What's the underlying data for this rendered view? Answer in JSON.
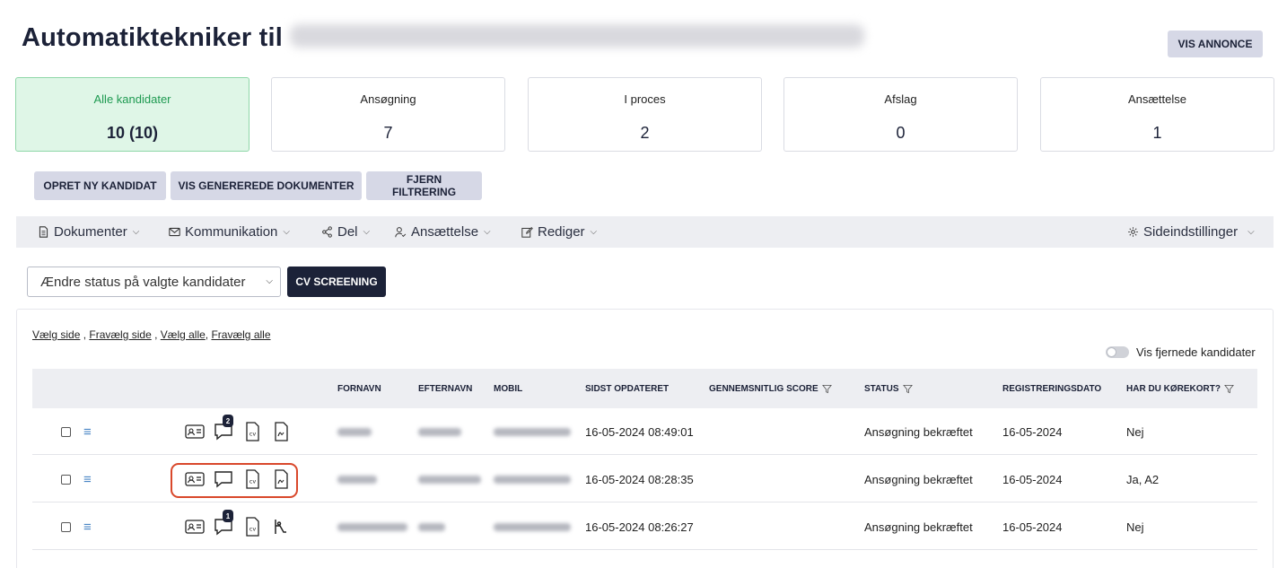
{
  "header": {
    "title": "Automatiktekniker til",
    "vis_annonce": "VIS ANNONCE"
  },
  "stats": [
    {
      "label": "Alle kandidater",
      "value": "10 (10)"
    },
    {
      "label": "Ansøgning",
      "value": "7"
    },
    {
      "label": "I proces",
      "value": "2"
    },
    {
      "label": "Afslag",
      "value": "0"
    },
    {
      "label": "Ansættelse",
      "value": "1"
    }
  ],
  "actions": {
    "opret": "OPRET NY KANDIDAT",
    "vis_docs": "VIS GENEREREDE DOKUMENTER",
    "fjern": "FJERN FILTRERING"
  },
  "toolbar": {
    "dokumenter": "Dokumenter",
    "kommunikation": "Kommunikation",
    "del": "Del",
    "ansaettelse": "Ansættelse",
    "rediger": "Rediger",
    "sideindstillinger": "Sideindstillinger"
  },
  "status_select": {
    "value": "Ændre status på valgte kandidater"
  },
  "cv_screening": "CV SCREENING",
  "select_links": {
    "vaelg_side": "Vælg side",
    "fravaelg_side": "Fravælg side",
    "vaelg_alle": "Vælg alle",
    "fravaelg_alle": "Fravælg alle"
  },
  "toggle_label": "Vis fjernede kandidater",
  "table": {
    "columns": {
      "fornavn": "FORNAVN",
      "efternavn": "EFTERNAVN",
      "mobil": "MOBIL",
      "sidst": "SIDST OPDATERET",
      "score": "GENNEMSNITLIG SCORE",
      "status": "STATUS",
      "reg": "REGISTRERINGSDATO",
      "korekort": "HAR DU KØREKORT?"
    },
    "rows": [
      {
        "updated": "16-05-2024 08:49:01",
        "status": "Ansøgning bekræftet",
        "reg_date": "16-05-2024",
        "korekort": "Nej",
        "badge": "2"
      },
      {
        "updated": "16-05-2024 08:28:35",
        "status": "Ansøgning bekræftet",
        "reg_date": "16-05-2024",
        "korekort": "Ja, A2",
        "badge": ""
      },
      {
        "updated": "16-05-2024 08:26:27",
        "status": "Ansøgning bekræftet",
        "reg_date": "16-05-2024",
        "korekort": "Nej",
        "badge": "1"
      }
    ]
  },
  "colors": {
    "primary": "#1c2238",
    "secondary_btn": "#d6d8e6",
    "active_card_bg": "#dff6e7",
    "active_text": "#1e9a51",
    "highlight": "#d9482b",
    "link_icon": "#4a86c5"
  }
}
